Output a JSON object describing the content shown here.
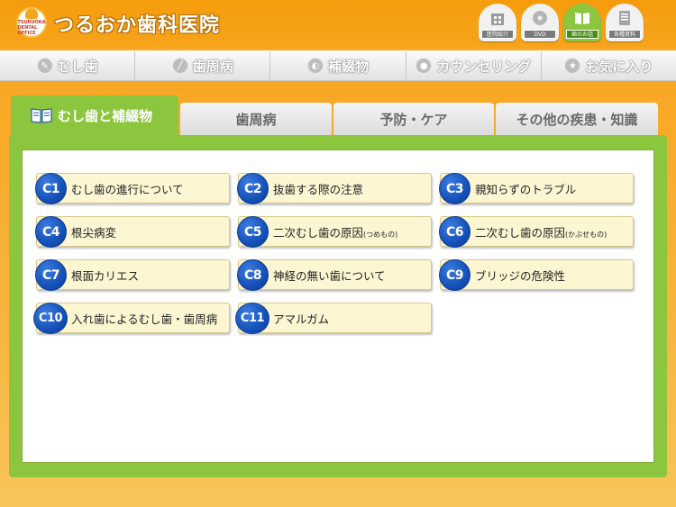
{
  "header": {
    "logo_text": "TSURUOKA DENTAL OFFICE",
    "clinic_name": "つるおか歯科医院",
    "icons": [
      {
        "icon": "building-icon",
        "label": "医院紹介"
      },
      {
        "icon": "dvd-icon",
        "label": "DVD"
      },
      {
        "icon": "book-icon",
        "label": "歯のお話"
      },
      {
        "icon": "document-icon",
        "label": "各種資料"
      }
    ]
  },
  "main_nav": {
    "items": [
      {
        "label": "むし歯"
      },
      {
        "label": "歯周病"
      },
      {
        "label": "補綴物"
      },
      {
        "label": "カウンセリング"
      },
      {
        "label": "お気に入り"
      }
    ]
  },
  "tabs": [
    {
      "label": "むし歯と補綴物"
    },
    {
      "label": "歯周病"
    },
    {
      "label": "予防・ケア"
    },
    {
      "label": "その他の疾患・知識"
    }
  ],
  "topics": [
    {
      "code": "C1",
      "label": "むし歯の進行について",
      "note": ""
    },
    {
      "code": "C2",
      "label": "抜歯する際の注意",
      "note": ""
    },
    {
      "code": "C3",
      "label": "親知らずのトラブル",
      "note": ""
    },
    {
      "code": "C4",
      "label": "根尖病変",
      "note": ""
    },
    {
      "code": "C5",
      "label": "二次むし歯の原因",
      "note": "(つめもの)"
    },
    {
      "code": "C6",
      "label": "二次むし歯の原因",
      "note": "(かぶせもの)"
    },
    {
      "code": "C7",
      "label": "根面カリエス",
      "note": ""
    },
    {
      "code": "C8",
      "label": "神経の無い歯について",
      "note": ""
    },
    {
      "code": "C9",
      "label": "ブリッジの危険性",
      "note": ""
    },
    {
      "code": "C10",
      "label": "入れ歯によるむし歯・歯周病",
      "note": ""
    },
    {
      "code": "C11",
      "label": "アマルガム",
      "note": ""
    }
  ],
  "colors": {
    "accent_green": "#8cc63f",
    "header_orange": "#f7a41c",
    "code_blue": "#1551b8",
    "topic_bg": "#fdf6d3"
  }
}
